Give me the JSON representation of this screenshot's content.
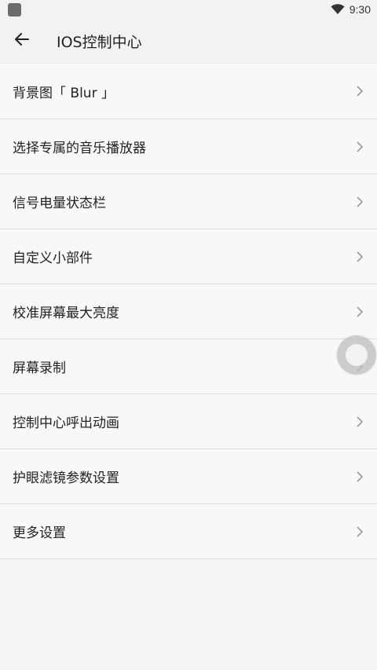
{
  "status_bar": {
    "time": "9:30",
    "app_icon": "square-notification-icon",
    "wifi_icon": "wifi-icon"
  },
  "app_bar": {
    "title": "IOS控制中心",
    "back_icon": "arrow-left-icon"
  },
  "menu": {
    "items": [
      {
        "label": "背景图「 Blur 」"
      },
      {
        "label": "选择专属的音乐播放器"
      },
      {
        "label": "信号电量状态栏"
      },
      {
        "label": "自定义小部件"
      },
      {
        "label": "校准屏幕最大亮度"
      },
      {
        "label": "屏幕录制"
      },
      {
        "label": "控制中心呼出动画"
      },
      {
        "label": "护眼滤镜参数设置"
      },
      {
        "label": "更多设置"
      }
    ],
    "chevron_icon": "chevron-right-icon"
  },
  "floating_button": {
    "icon": "assistive-touch-icon"
  },
  "colors": {
    "background": "#f5f5f5",
    "list_background": "#f8f8f8",
    "divider": "#dcdcdc",
    "text": "#222222",
    "chevron": "#9a9a9a"
  }
}
